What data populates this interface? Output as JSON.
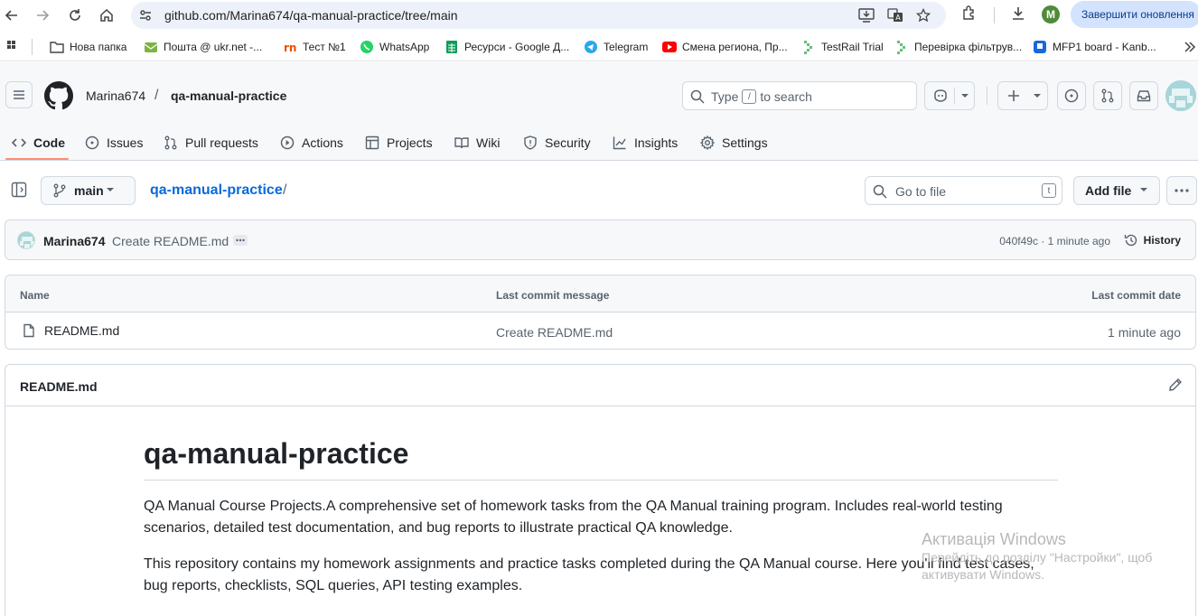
{
  "browser": {
    "url": "github.com/Marina674/qa-manual-practice/tree/main",
    "profile_initial": "M",
    "update_button": "Завершити оновлення",
    "bookmarks": [
      {
        "label": "Нова папка",
        "icon": "folder-icon"
      },
      {
        "label": "Пошта @ ukr.net -...",
        "icon": "mail-icon"
      },
      {
        "label": "Тест №1",
        "icon": "test-icon"
      },
      {
        "label": "WhatsApp",
        "icon": "whatsapp-icon"
      },
      {
        "label": "Ресурси - Google Д...",
        "icon": "sheets-icon"
      },
      {
        "label": "Telegram",
        "icon": "telegram-icon"
      },
      {
        "label": "Смена региона, Пр...",
        "icon": "youtube-icon"
      },
      {
        "label": "TestRail Trial",
        "icon": "testrail-icon"
      },
      {
        "label": "Перевірка фільтрув...",
        "icon": "testrail-icon"
      },
      {
        "label": "MFP1 board - Kanb...",
        "icon": "jira-icon"
      }
    ]
  },
  "header": {
    "owner": "Marina674",
    "separator": "/",
    "repo": "qa-manual-practice",
    "search_before": "Type",
    "search_key": "/",
    "search_after": "to search"
  },
  "tabs": [
    {
      "label": "Code",
      "icon": "code-icon"
    },
    {
      "label": "Issues",
      "icon": "issue-icon"
    },
    {
      "label": "Pull requests",
      "icon": "pull-request-icon"
    },
    {
      "label": "Actions",
      "icon": "play-icon"
    },
    {
      "label": "Projects",
      "icon": "table-icon"
    },
    {
      "label": "Wiki",
      "icon": "book-icon"
    },
    {
      "label": "Security",
      "icon": "shield-icon"
    },
    {
      "label": "Insights",
      "icon": "graph-icon"
    },
    {
      "label": "Settings",
      "icon": "gear-icon"
    }
  ],
  "filenav": {
    "branch": "main",
    "repo_link": "qa-manual-practice",
    "slash": "/",
    "goto_placeholder": "Go to file",
    "goto_key": "t",
    "add_file": "Add file"
  },
  "commit": {
    "author": "Marina674",
    "message": "Create README.md",
    "meta": "040f49c · 1 minute ago",
    "history": "History"
  },
  "files_table": {
    "headers": [
      "Name",
      "Last commit message",
      "Last commit date"
    ],
    "rows": [
      {
        "name": "README.md",
        "message": "Create README.md",
        "date": "1 minute ago"
      }
    ]
  },
  "readme": {
    "title": "README.md",
    "heading": "qa-manual-practice",
    "p1": "QA Manual Course Projects.A comprehensive set of homework tasks from the QA Manual training program. Includes real-world testing scenarios, detailed test documentation, and bug reports to illustrate practical QA knowledge.",
    "p2": "This repository contains my homework assignments and practice tasks completed during the QA Manual course. Here you'll find test cases, bug reports, checklists, SQL queries, API testing examples."
  },
  "watermark": {
    "line1": "Активація Windows",
    "line2": "Перейдіть до розділу \"Настройки\", щоб",
    "line3": "активувати Windows."
  },
  "colors": {
    "link": "#0969da",
    "tab_underline": "#fd8c73",
    "border": "#d1d9e0",
    "muted": "#59636e"
  }
}
